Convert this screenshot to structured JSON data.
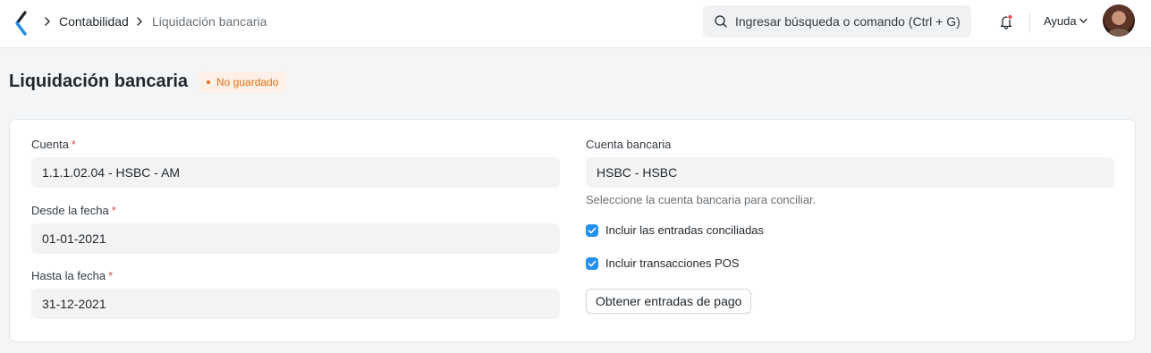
{
  "navbar": {
    "breadcrumbs": [
      "Contabilidad",
      "Liquidación bancaria"
    ],
    "search_placeholder": "Ingresar búsqueda o comando (Ctrl + G)",
    "help_label": "Ayuda",
    "icons": {
      "logo": "app-logo-icon",
      "breadcrumb_separator": "chevron-right-icon",
      "search": "search-icon",
      "notifications": "bell-icon",
      "help_dropdown": "chevron-down-icon"
    }
  },
  "page": {
    "title": "Liquidación bancaria",
    "status_badge": "No guardado"
  },
  "form": {
    "account": {
      "label": "Cuenta",
      "required_mark": "*",
      "value": "1.1.1.02.04 - HSBC - AM"
    },
    "from_date": {
      "label": "Desde la fecha",
      "required_mark": "*",
      "value": "01-01-2021"
    },
    "to_date": {
      "label": "Hasta la fecha",
      "required_mark": "*",
      "value": "31-12-2021"
    },
    "bank_account": {
      "label": "Cuenta bancaria",
      "value": "HSBC - HSBC",
      "description": "Seleccione la cuenta bancaria para conciliar."
    },
    "include_reconciled": {
      "label": "Incluir las entradas conciliadas",
      "checked": true
    },
    "include_pos": {
      "label": "Incluir transacciones POS",
      "checked": true
    },
    "get_entries_button": "Obtener entradas de pago"
  },
  "colors": {
    "accent": "#2490ef",
    "badge_text": "#e86c13",
    "badge_bg": "#fff1e7",
    "required": "#e24c4c"
  }
}
